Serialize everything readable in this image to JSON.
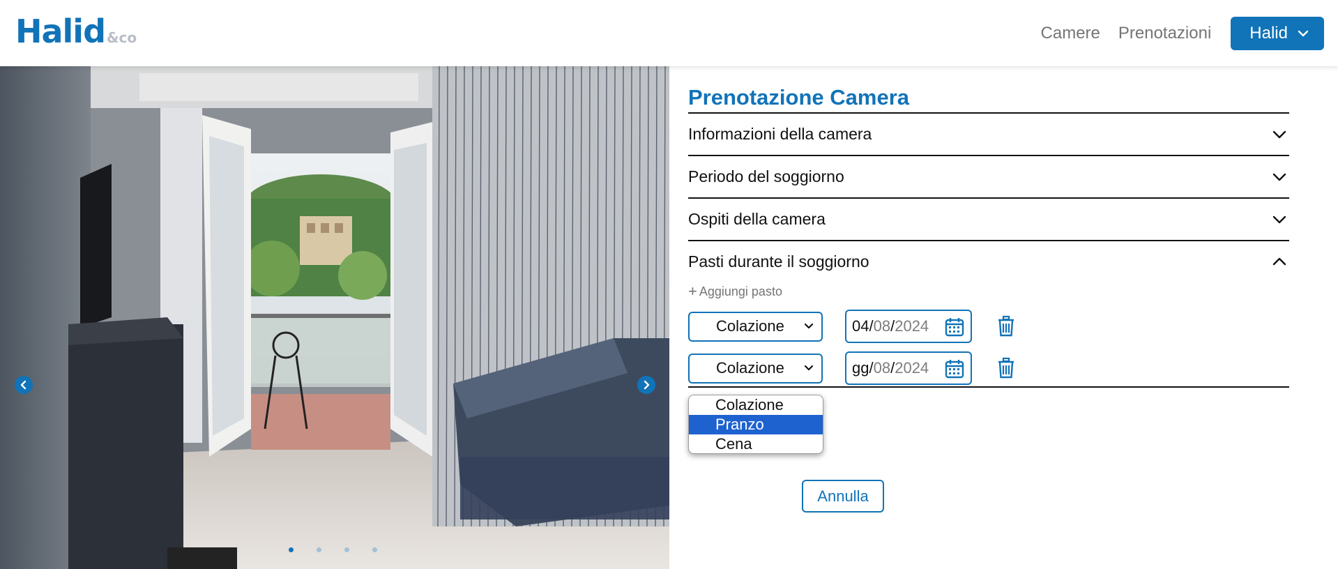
{
  "brand": {
    "name": "Halid",
    "suffix": "&co"
  },
  "nav": {
    "links": [
      "Camere",
      "Prenotazioni"
    ],
    "user_label": "Halid"
  },
  "hero": {
    "slide_count": 4,
    "active_slide": 1
  },
  "form": {
    "title": "Prenotazione Camera",
    "sections": [
      {
        "label": "Informazioni della camera",
        "open": false
      },
      {
        "label": "Periodo del soggiorno",
        "open": false
      },
      {
        "label": "Ospiti della camera",
        "open": false
      },
      {
        "label": "Pasti durante il soggiorno",
        "open": true
      }
    ],
    "add_meal_label": "Aggiungi pasto",
    "meals": [
      {
        "type": "Colazione",
        "date_day": "04",
        "date_month": "08",
        "date_year": "2024",
        "day_filled": true
      },
      {
        "type": "Colazione",
        "date_day": "gg",
        "date_month": "08",
        "date_year": "2024",
        "day_filled": false
      }
    ],
    "cancel_label": "Annulla"
  },
  "dropdown": {
    "options": [
      "Colazione",
      "Pranzo",
      "Cena"
    ],
    "highlighted": "Pranzo"
  },
  "colors": {
    "accent": "#1173b8",
    "highlight": "#1e62d0"
  }
}
